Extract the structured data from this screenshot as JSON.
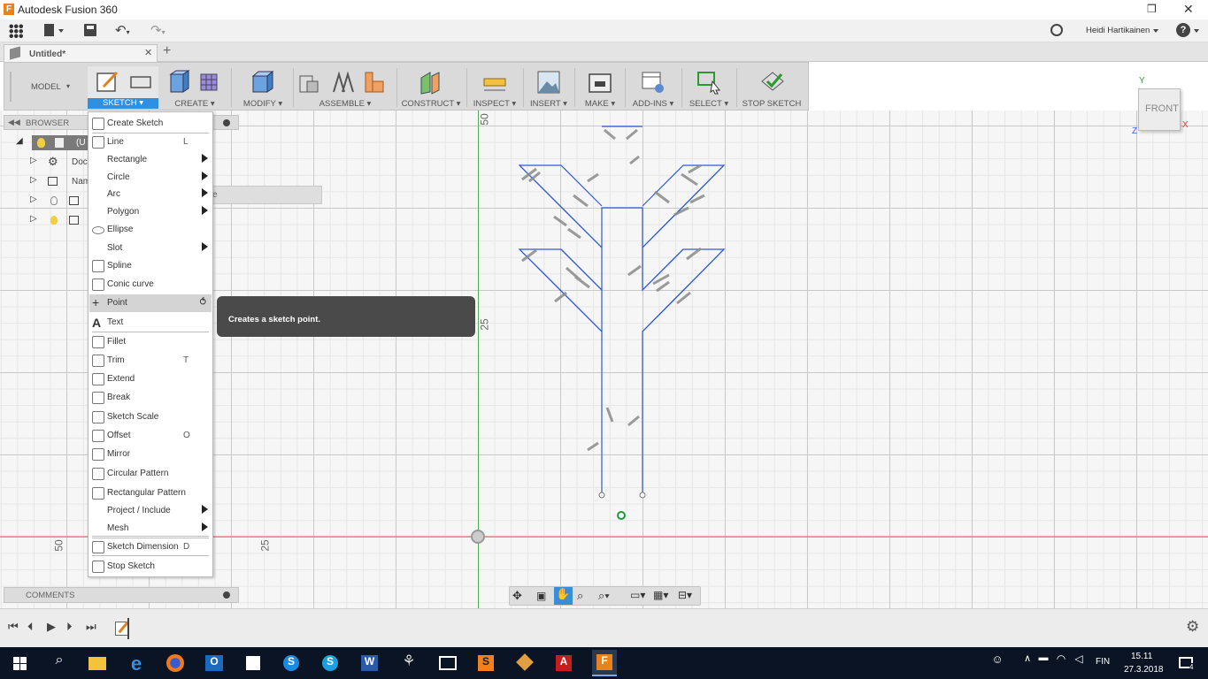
{
  "window": {
    "title": "Autodesk Fusion 360"
  },
  "user": {
    "name": "Heidi Hartikainen"
  },
  "tab": {
    "title": "Untitled*"
  },
  "ribbon": {
    "workspace": "MODEL",
    "groups": [
      {
        "label": "SKETCH ▾",
        "icon": "sketch-icon"
      },
      {
        "label": "CREATE ▾",
        "icon": "box-icon"
      },
      {
        "label": "MODIFY ▾",
        "icon": "press-pull-icon"
      },
      {
        "label": "ASSEMBLE ▾",
        "icon": "joint-icon"
      },
      {
        "label": "CONSTRUCT ▾",
        "icon": "plane-icon"
      },
      {
        "label": "INSPECT ▾",
        "icon": "measure-icon"
      },
      {
        "label": "INSERT ▾",
        "icon": "image-icon"
      },
      {
        "label": "MAKE ▾",
        "icon": "3d-print-icon"
      },
      {
        "label": "ADD-INS ▾",
        "icon": "scripts-icon"
      },
      {
        "label": "SELECT ▾",
        "icon": "select-icon"
      },
      {
        "label": "STOP SKETCH",
        "icon": "stop-sketch-icon"
      }
    ]
  },
  "browser": {
    "title": "BROWSER",
    "items": [
      "Doc",
      "Nam"
    ],
    "root_fragment": "(U",
    "hidden_fragment": "e"
  },
  "comments": {
    "title": "COMMENTS"
  },
  "sketch_menu": {
    "items": [
      {
        "label": "Create Sketch",
        "shortcut": "",
        "submenu": false,
        "icon": "create-sketch-icon"
      },
      {
        "label": "Line",
        "shortcut": "L",
        "submenu": false,
        "icon": "line-icon"
      },
      {
        "label": "Rectangle",
        "shortcut": "",
        "submenu": true,
        "icon": ""
      },
      {
        "label": "Circle",
        "shortcut": "",
        "submenu": true,
        "icon": ""
      },
      {
        "label": "Arc",
        "shortcut": "",
        "submenu": true,
        "icon": ""
      },
      {
        "label": "Polygon",
        "shortcut": "",
        "submenu": true,
        "icon": ""
      },
      {
        "label": "Ellipse",
        "shortcut": "",
        "submenu": false,
        "icon": "ellipse-icon"
      },
      {
        "label": "Slot",
        "shortcut": "",
        "submenu": true,
        "icon": ""
      },
      {
        "label": "Spline",
        "shortcut": "",
        "submenu": false,
        "icon": "spline-icon"
      },
      {
        "label": "Conic curve",
        "shortcut": "",
        "submenu": false,
        "icon": "conic-curve-icon"
      },
      {
        "label": "Point",
        "shortcut": "",
        "submenu": false,
        "icon": "point-icon"
      },
      {
        "label": "Text",
        "shortcut": "",
        "submenu": false,
        "icon": "text-icon"
      },
      {
        "label": "Fillet",
        "shortcut": "",
        "submenu": false,
        "icon": "fillet-icon"
      },
      {
        "label": "Trim",
        "shortcut": "T",
        "submenu": false,
        "icon": "trim-icon"
      },
      {
        "label": "Extend",
        "shortcut": "",
        "submenu": false,
        "icon": "extend-icon"
      },
      {
        "label": "Break",
        "shortcut": "",
        "submenu": false,
        "icon": "break-icon"
      },
      {
        "label": "Sketch Scale",
        "shortcut": "",
        "submenu": false,
        "icon": "sketch-scale-icon"
      },
      {
        "label": "Offset",
        "shortcut": "O",
        "submenu": false,
        "icon": "offset-icon"
      },
      {
        "label": "Mirror",
        "shortcut": "",
        "submenu": false,
        "icon": "mirror-icon"
      },
      {
        "label": "Circular Pattern",
        "shortcut": "",
        "submenu": false,
        "icon": "circular-pattern-icon"
      },
      {
        "label": "Rectangular Pattern",
        "shortcut": "",
        "submenu": false,
        "icon": "rectangular-pattern-icon"
      },
      {
        "label": "Project / Include",
        "shortcut": "",
        "submenu": true,
        "icon": ""
      },
      {
        "label": "Mesh",
        "shortcut": "",
        "submenu": true,
        "icon": ""
      },
      {
        "label": "Sketch Dimension",
        "shortcut": "D",
        "submenu": false,
        "icon": "sketch-dimension-icon"
      },
      {
        "label": "Stop Sketch",
        "shortcut": "",
        "submenu": false,
        "icon": "stop-sketch-icon"
      }
    ],
    "highlighted": "Point"
  },
  "tooltip": {
    "text": "Creates a sketch point."
  },
  "viewcube": {
    "face": "FRONT",
    "axis_y": "Y",
    "axis_z": "Z",
    "axis_x": "X"
  },
  "canvas": {
    "rulers": {
      "v_50": "50",
      "v_25": "25",
      "h_50": "50",
      "h_25": "25"
    }
  },
  "taskbar": {
    "time": "15.11",
    "date": "27.3.2018",
    "lang": "FIN",
    "notifications": "4"
  }
}
